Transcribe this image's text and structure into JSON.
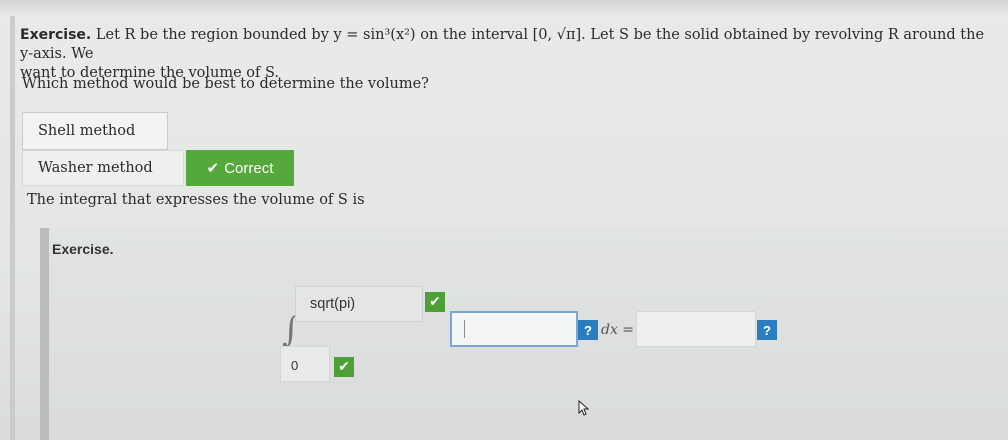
{
  "problem": {
    "label": "Exercise.",
    "line1": "Let R be the region bounded by y = sin³(x²) on the interval [0, √π]. Let S be the solid obtained by revolving R around the y-axis. We",
    "line2": "want to determine the volume of S."
  },
  "question": "Which method would be best to determine the volume?",
  "options": {
    "shell": "Shell method",
    "washer": "Washer method"
  },
  "feedback": {
    "correct": "Correct"
  },
  "integral_prompt": "The integral that expresses the volume of S is",
  "sub_exercise": {
    "title": "Exercise.",
    "upper_limit": "sqrt(pi)",
    "lower_limit": "0",
    "integrand_value": "",
    "dx_label": "dx =",
    "answer_value": "",
    "help_label": "?"
  },
  "colors": {
    "correct_green": "#55a83a",
    "help_blue": "#2c7dc0",
    "focus_border": "#7ca5cf"
  },
  "icons": [
    "check-icon",
    "integral-sign",
    "mouse-cursor-icon"
  ]
}
